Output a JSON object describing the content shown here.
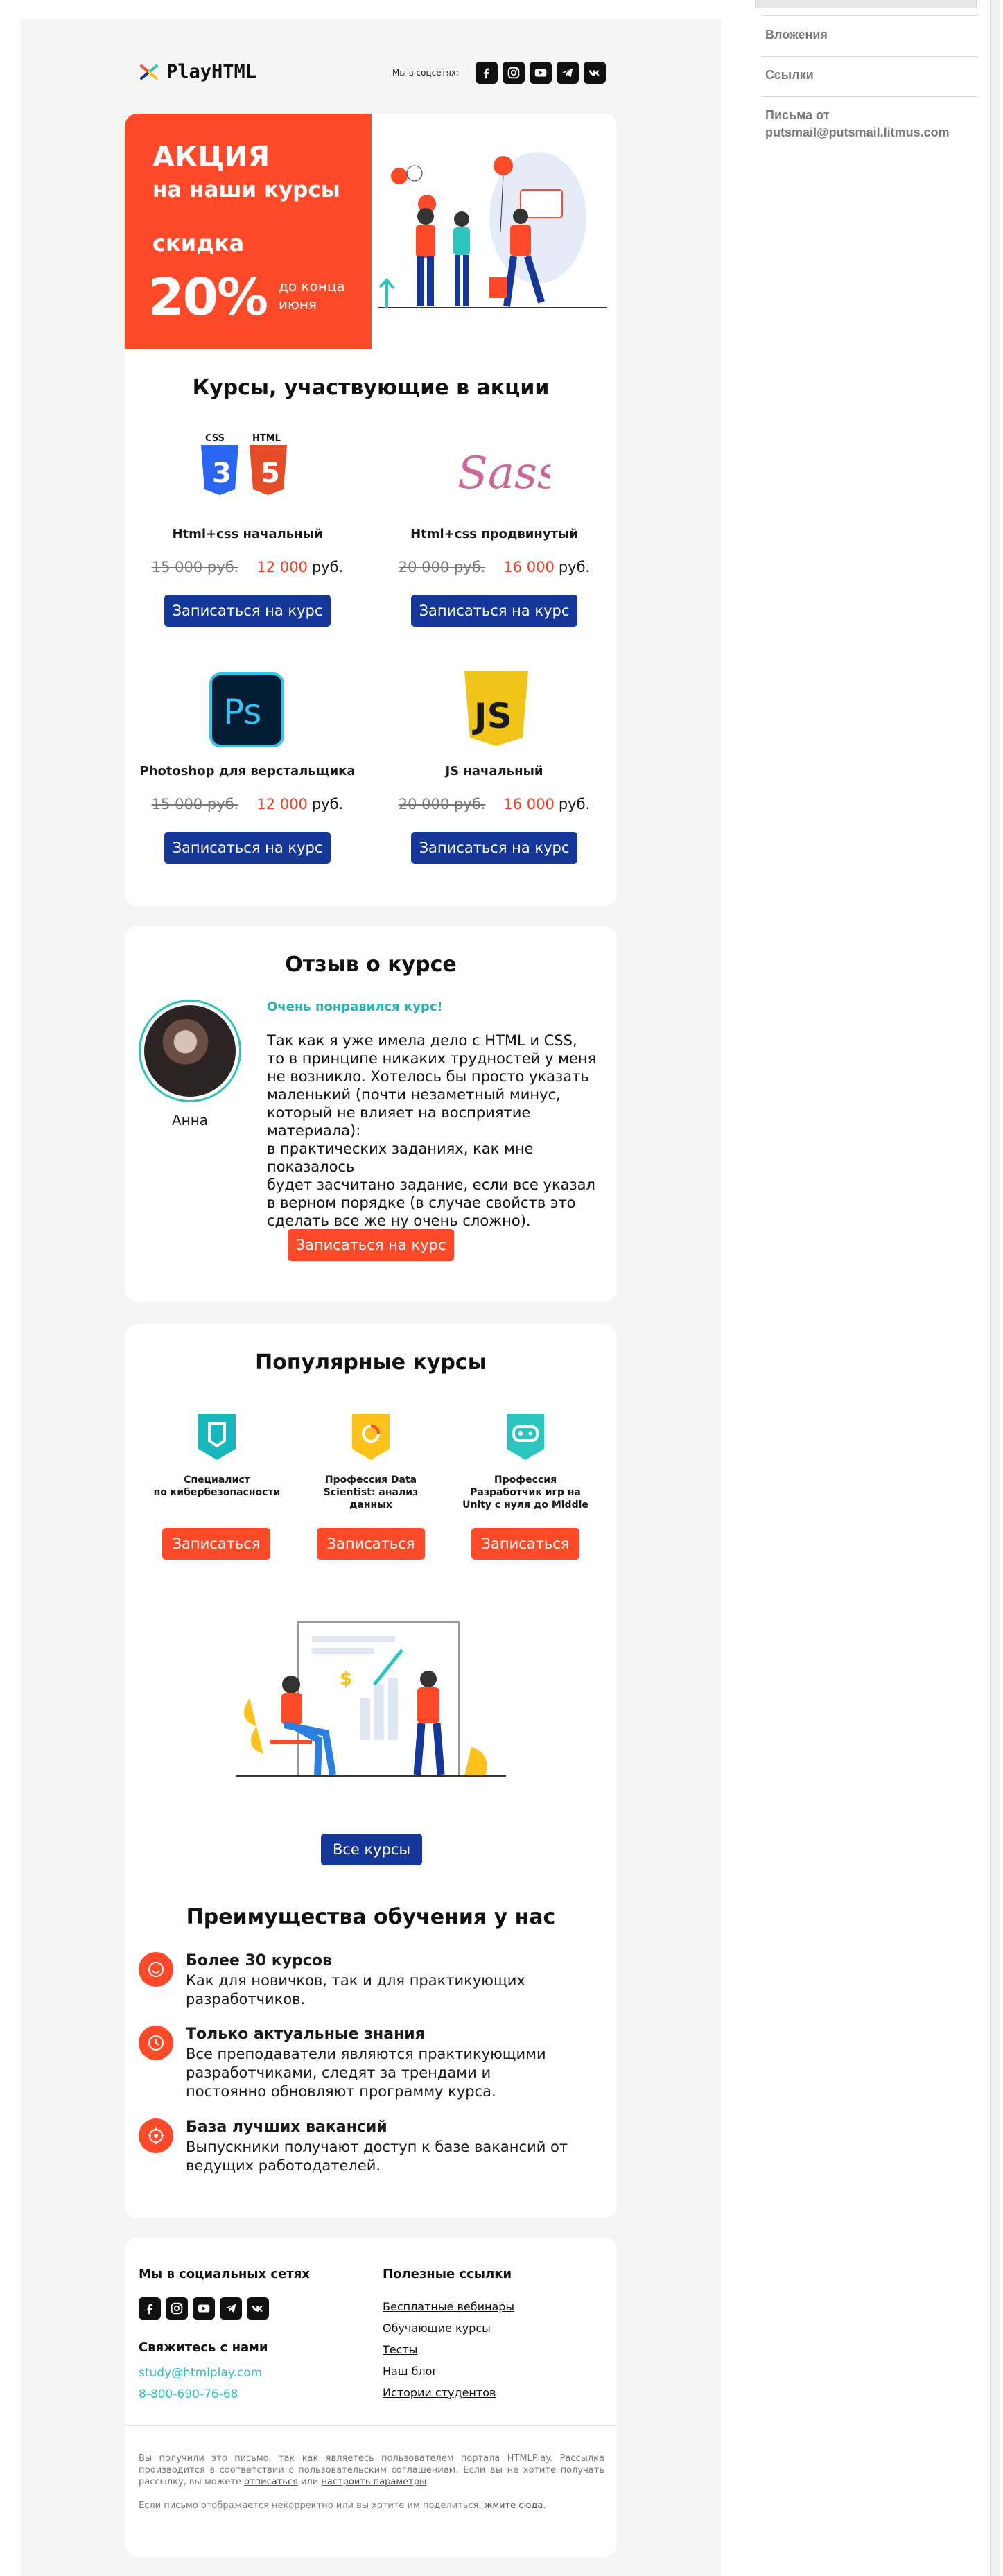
{
  "colors": {
    "accent_red": "#ff4a2a",
    "brand_blue": "#143799",
    "teal": "#2bc5c0",
    "page_bg": "#f5f5f5"
  },
  "sidebar": {
    "items": [
      "Вложения",
      "Ссылки"
    ],
    "from_label": "Письма от",
    "from_address": "putsmail@putsmail.litmus.com"
  },
  "header": {
    "logo_text": "PlayHTML",
    "social_label": "Мы в соцсетях:",
    "social_icons": [
      "facebook-icon",
      "instagram-icon",
      "youtube-icon",
      "telegram-icon",
      "vk-icon"
    ]
  },
  "promo": {
    "title": "АКЦИЯ",
    "subtitle": "на наши курсы",
    "discount_label": "скидка",
    "discount_value": "20%",
    "until": "до конца июня"
  },
  "courses": {
    "title": "Курсы, участвующие в акции",
    "currency": "руб.",
    "items": [
      {
        "name": "Html+css начальный",
        "old_price": "15 000 руб.",
        "new_price": "12 000",
        "button": "Записаться на курс",
        "icon": "html-css-icon"
      },
      {
        "name": "Html+css продвинутый",
        "old_price": "20 000 руб.",
        "new_price": "16 000",
        "button": "Записаться на курс",
        "icon": "sass-icon"
      },
      {
        "name": "Photoshop для верстальщика",
        "old_price": "15 000 руб.",
        "new_price": "12 000",
        "button": "Записаться на курс",
        "icon": "photoshop-icon"
      },
      {
        "name": "JS начальный",
        "old_price": "20 000 руб.",
        "new_price": "16 000",
        "button": "Записаться на курс",
        "icon": "js-icon"
      }
    ]
  },
  "review": {
    "title": "Отзыв о курсе",
    "author": "Анна",
    "headline": "Очень понравился курс!",
    "lines": [
      "Так как я уже имела дело с HTML и CSS,",
      "то в принципе никаких трудностей у меня",
      "не возникло. Хотелось бы просто указать",
      "маленький (почти незаметный минус,",
      "который не влияет на восприятие материала):",
      "в практических заданиях, как мне показалось",
      "будет засчитано задание, если все указал",
      "в верном порядке (в случае свойств это",
      "сделать все же ну очень сложно)."
    ],
    "button": "Записаться на курс"
  },
  "popular": {
    "title": "Популярные курсы",
    "items": [
      {
        "line1": "Специалист",
        "line2": "по кибербезопасности",
        "line3": "",
        "button": "Записаться"
      },
      {
        "line1": "Профессия Data",
        "line2": "Scientist: анализ",
        "line3": "данных",
        "button": "Записаться"
      },
      {
        "line1": "Профессия",
        "line2": "Разработчик игр на",
        "line3": "Unity с нуля до Middle",
        "button": "Записаться"
      }
    ],
    "all_button": "Все курсы"
  },
  "advantages": {
    "title": "Преимущества обучения у нас",
    "items": [
      {
        "title": "Более 30 курсов",
        "text": "Как для новичков, так и для практикующих разработчиков.",
        "icon": "smile-icon"
      },
      {
        "title": "Только актуальные знания",
        "text": "Все преподаватели являются практикующими разработчиками, следят за трендами и постоянно обновляют программу курса.",
        "icon": "clock-icon"
      },
      {
        "title": "База лучших вакансий",
        "text": "Выпускники получают доступ к базе вакансий от ведущих работодателей.",
        "icon": "target-icon"
      }
    ]
  },
  "footer": {
    "social_title": "Мы в социальных сетях",
    "contact_title": "Свяжитесь с нами",
    "email": "study@htmlplay.com",
    "phone": "8-800-690-76-68",
    "links_title": "Полезные ссылки",
    "links": [
      "Бесплатные вебинары",
      "Обучающие курсы",
      "Тесты",
      "Наш блог",
      "Истории студентов"
    ],
    "legal_1": "Вы получили это письмо, так как являетесь пользователем портала HTMLPlay. Рассылка производится в соответствии с пользовательским соглашением. Если вы не хотите получать рассылку, вы можете",
    "legal_unsub": "отписаться",
    "legal_or": " или ",
    "legal_settings": "настроить параметры",
    "legal_end": ".",
    "legal_2": "Если письмо отображается некорректно или вы хотите им поделиться,",
    "legal_here": "жмите сюда"
  }
}
